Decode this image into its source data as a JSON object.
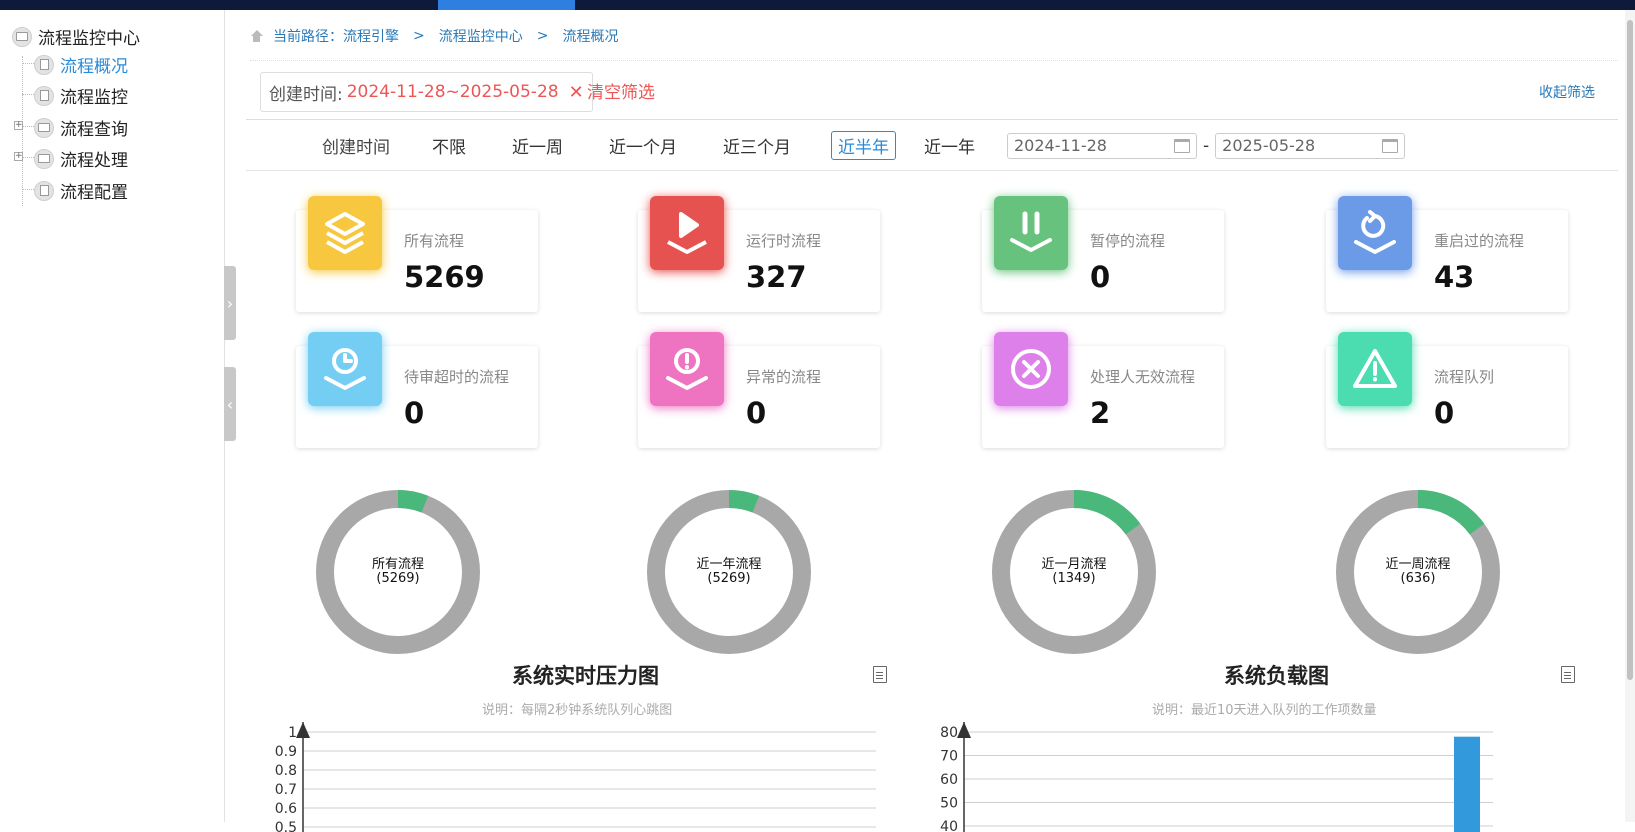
{
  "sidebar": {
    "root": "流程监控中心",
    "items": [
      {
        "label": "流程概况",
        "selected": true,
        "icon": "doc-icon"
      },
      {
        "label": "流程监控",
        "icon": "doc-icon"
      },
      {
        "label": "流程查询",
        "icon": "folder-icon",
        "expandable": true
      },
      {
        "label": "流程处理",
        "icon": "folder-icon",
        "expandable": true
      },
      {
        "label": "流程配置",
        "icon": "doc-icon"
      }
    ]
  },
  "breadcrumb": {
    "prefix": "当前路径：流程引擎",
    "sep": ">",
    "level2": "流程监控中心",
    "level3": "流程概况"
  },
  "filter": {
    "chip_label": "创建时间:",
    "chip_value": "2024-11-28~2025-05-28",
    "clear": "清空筛选",
    "collapse": "收起筛选"
  },
  "range": {
    "label": "创建时间",
    "options": [
      "不限",
      "近一周",
      "近一个月",
      "近三个月",
      "近半年",
      "近一年"
    ],
    "active": "近半年",
    "start": "2024-11-28",
    "end": "2025-05-28",
    "sep": "-"
  },
  "stats": [
    {
      "label": "所有流程",
      "value": "5269",
      "color": "#f7c83f",
      "icon": "layers-icon"
    },
    {
      "label": "运行时流程",
      "value": "327",
      "color": "#e5524f",
      "icon": "play-icon"
    },
    {
      "label": "暂停的流程",
      "value": "0",
      "color": "#66c27c",
      "icon": "pause-icon"
    },
    {
      "label": "重启过的流程",
      "value": "43",
      "color": "#6b9be6",
      "icon": "restart-icon"
    },
    {
      "label": "待审超时的流程",
      "value": "0",
      "color": "#74cdf2",
      "icon": "clock-icon"
    },
    {
      "label": "异常的流程",
      "value": "0",
      "color": "#ee74c2",
      "icon": "exclamation-icon"
    },
    {
      "label": "处理人无效流程",
      "value": "2",
      "color": "#dd80e9",
      "icon": "x-circle-icon"
    },
    {
      "label": "流程队列",
      "value": "0",
      "color": "#4bdcb0",
      "icon": "warning-icon"
    }
  ],
  "donuts": [
    {
      "title": "所有流程",
      "count": "(5269)",
      "fraction": 0.06
    },
    {
      "title": "近一年流程",
      "count": "(5269)",
      "fraction": 0.06
    },
    {
      "title": "近一月流程",
      "count": "(1349)",
      "fraction": 0.15
    },
    {
      "title": "近一周流程",
      "count": "(636)",
      "fraction": 0.15
    }
  ],
  "colors": {
    "donut_track": "#a8a8a8",
    "donut_fill": "#49b87a",
    "bar": "#3399dd"
  },
  "panels": [
    {
      "title": "系统实时压力图",
      "subtitle": "说明：每隔2秒钟系统队列心跳图"
    },
    {
      "title": "系统负载图",
      "subtitle": "说明：最近10天进入队列的工作项数量"
    }
  ],
  "chart_data": [
    {
      "type": "line",
      "title": "系统实时压力图",
      "ylabels": [
        "1",
        "0.9",
        "0.8",
        "0.7",
        "0.6",
        "0.5"
      ],
      "ylim": [
        0,
        1
      ],
      "series": []
    },
    {
      "type": "bar",
      "title": "系统负载图",
      "ylabels": [
        "80",
        "70",
        "60",
        "50",
        "40"
      ],
      "ylim": [
        0,
        80
      ],
      "series": [
        {
          "values": [
            78
          ]
        }
      ]
    }
  ]
}
